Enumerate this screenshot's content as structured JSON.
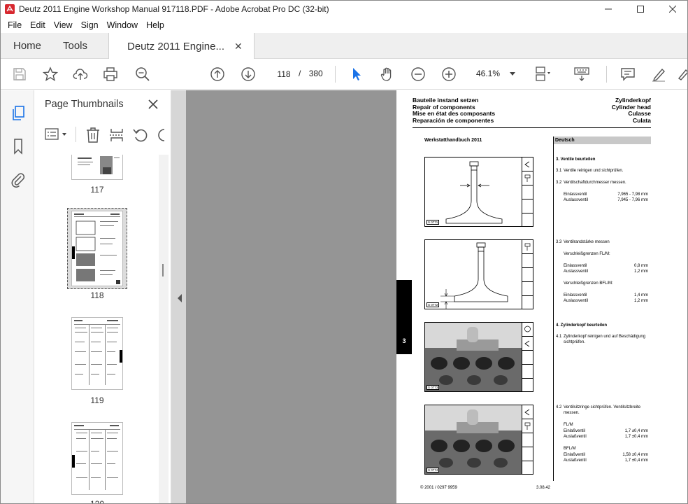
{
  "window": {
    "title": "Deutz 2011 Engine Workshop Manual 917118.PDF - Adobe Acrobat Pro DC (32-bit)"
  },
  "menu": {
    "items": [
      "File",
      "Edit",
      "View",
      "Sign",
      "Window",
      "Help"
    ]
  },
  "tabs": {
    "home": "Home",
    "tools": "Tools",
    "document": "Deutz 2011 Engine..."
  },
  "toolbar": {
    "current_page": "118",
    "page_separator": "/",
    "total_pages": "380",
    "zoom": "46.1%"
  },
  "thumbnails_panel": {
    "title": "Page Thumbnails",
    "pages": [
      "117",
      "118",
      "119",
      "120"
    ],
    "selected_page": "118"
  },
  "document_page": {
    "header_left": [
      "Bauteile instand setzen",
      "Repair of components",
      "Mise en état des composants",
      "Reparación de componentes"
    ],
    "header_right": [
      "Zylinderkopf",
      "Cylinder head",
      "Culasse",
      "Culata"
    ],
    "manual_title": "Werkstatthandbuch 2011",
    "language": "Deutsch",
    "section_tab": "3",
    "steps": {
      "s3": "3.   Ventile beurteilen",
      "s31": "Ventile reinigen und sichtprüfen.",
      "s32": "Ventilschaftdurchmesser messen.",
      "s32_rows": [
        {
          "label": "Einlassventil",
          "value": "7,965 - 7,98 mm"
        },
        {
          "label": "Auslassventil",
          "value": "7,945 - 7,96 mm"
        }
      ],
      "s33": "Ventilrandstärke messen",
      "s33_sub1": "Verschleißgrenzen FL/M:",
      "s33_rows1": [
        {
          "label": "Einlassventil",
          "value": "0,8 mm"
        },
        {
          "label": "Auslassventil",
          "value": "1,2 mm"
        }
      ],
      "s33_sub2": "Verschleißgrenzen BFL/M:",
      "s33_rows2": [
        {
          "label": "Einlassventil",
          "value": "1,4 mm"
        },
        {
          "label": "Auslassventil",
          "value": "1,2 mm"
        }
      ],
      "s4": "4.   Zylinderkopf beurteilen",
      "s41": "Zylinderkopf reinigen und auf Beschädigung sichtprüfen.",
      "s42": "Ventilsitzringe sichtprüfen. Ventilsitzbreite messen.",
      "s42_sub1": "FL/M",
      "s42_rows1": [
        {
          "label": "Einlaßventil",
          "value": "1,7 ±0,4 mm"
        },
        {
          "label": "Auslaßventil",
          "value": "1,7 ±0,4 mm"
        }
      ],
      "s42_sub2": "BFL/M",
      "s42_rows2": [
        {
          "label": "Einlaßventil",
          "value": "1,58 ±0,4 mm"
        },
        {
          "label": "Auslaßventil",
          "value": "1,7 ±0,4 mm"
        }
      ],
      "num_31": "3.1",
      "num_32": "3.2",
      "num_33": "3.3",
      "num_41": "4.1",
      "num_42": "4.2"
    },
    "footer_left": "© 2001 / 0297 9959",
    "footer_right": "3.08.42"
  },
  "colors": {
    "acrobat_red": "#d7282f",
    "tab_bar": "#efefef",
    "doc_gray": "#959595",
    "selection_blue": "#1a73e8"
  }
}
